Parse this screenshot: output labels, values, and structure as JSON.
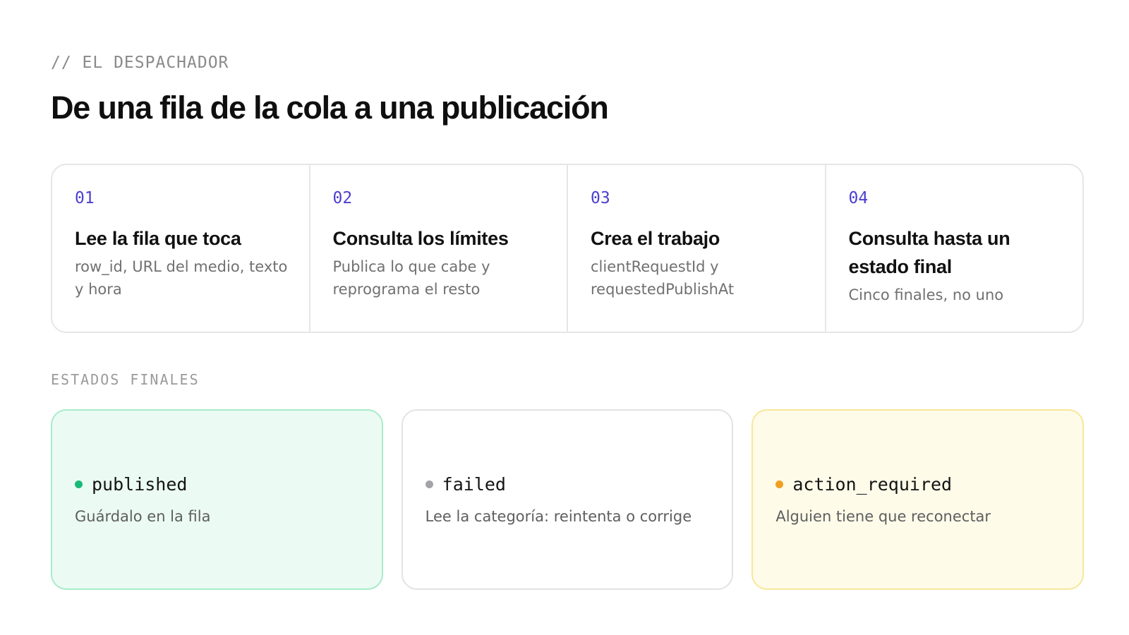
{
  "header": {
    "eyebrow": "// EL DESPACHADOR",
    "title": "De una fila de la cola a una publicación"
  },
  "steps": [
    {
      "number": "01",
      "title": "Lee la fila que toca",
      "description": "row_id, URL del medio, texto y hora"
    },
    {
      "number": "02",
      "title": "Consulta los límites",
      "description": "Publica lo que cabe y reprograma el resto"
    },
    {
      "number": "03",
      "title": "Crea el trabajo",
      "description": "clientRequestId y requestedPublishAt"
    },
    {
      "number": "04",
      "title": "Consulta hasta un estado final",
      "description": "Cinco finales, no uno"
    }
  ],
  "final_states": {
    "label": "ESTADOS FINALES",
    "items": [
      {
        "name": "published",
        "description": "Guárdalo en la fila",
        "dot_color": "#19b97a",
        "variant": "success"
      },
      {
        "name": "failed",
        "description": "Lee la categoría: reintenta o corrige",
        "dot_color": "#a3a3a8",
        "variant": "neutral"
      },
      {
        "name": "action_required",
        "description": "Alguien tiene que reconectar",
        "dot_color": "#f0a020",
        "variant": "warning"
      }
    ]
  },
  "colors": {
    "accent_number": "#4b3fd0",
    "success_bg": "#ebfbf3",
    "warning_bg": "#fefbe9"
  }
}
